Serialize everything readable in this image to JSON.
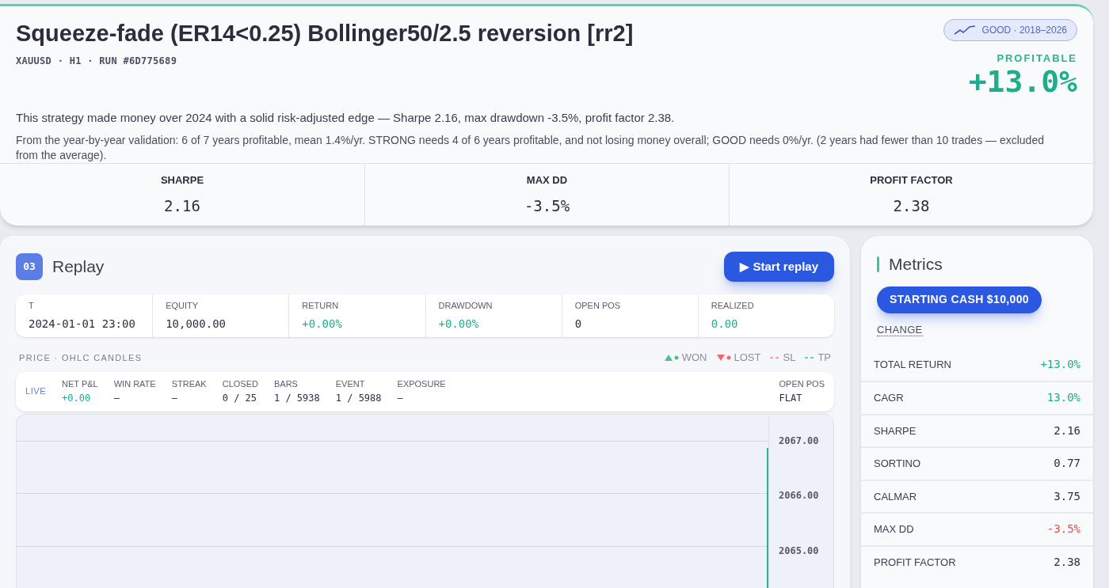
{
  "header": {
    "title": "Squeeze-fade (ER14<0.25) Bollinger50/2.5 reversion [rr2]",
    "subtitle": "XAUUSD · H1 · RUN #6D775689",
    "badge": "GOOD · 2018–2026",
    "verdict": "PROFITABLE",
    "return": "+13.0%",
    "summary": "This strategy made money over 2024 with a solid risk-adjusted edge — Sharpe 2.16, max drawdown -3.5%, profit factor 2.38.",
    "validation": "From the year-by-year validation: 6 of 7 years profitable, mean 1.4%/yr. STRONG needs 4 of 6 years profitable, and not losing money overall; GOOD needs 0%/yr. (2 years had fewer than 10 trades — excluded from the average).",
    "stats": [
      {
        "label": "SHARPE",
        "value": "2.16"
      },
      {
        "label": "MAX DD",
        "value": "-3.5%"
      },
      {
        "label": "PROFIT FACTOR",
        "value": "2.38"
      }
    ]
  },
  "replay": {
    "step": "03",
    "title": "Replay",
    "button": "▶ Start replay",
    "stats": [
      {
        "label": "T",
        "value": "2024-01-01 23:00",
        "color": "#2b2f3f"
      },
      {
        "label": "EQUITY",
        "value": "10,000.00",
        "color": "#2b2f3f"
      },
      {
        "label": "RETURN",
        "value": "+0.00%",
        "color": "#1fae8c"
      },
      {
        "label": "DRAWDOWN",
        "value": "+0.00%",
        "color": "#1fae8c"
      },
      {
        "label": "OPEN POS",
        "value": "0",
        "color": "#2b2f3f"
      },
      {
        "label": "REALIZED",
        "value": "0.00",
        "color": "#1fae8c"
      }
    ],
    "chart_title": "PRICE · OHLC CANDLES",
    "legend": [
      {
        "kind": "won",
        "label": "WON"
      },
      {
        "kind": "lost",
        "label": "LOST"
      },
      {
        "kind": "sl",
        "label": "SL"
      },
      {
        "kind": "tp",
        "label": "TP"
      }
    ],
    "live_label": "LIVE",
    "live_stats": [
      {
        "label": "NET P&L",
        "value": "+0.00",
        "color": "#1fae8c"
      },
      {
        "label": "WIN RATE",
        "value": "—"
      },
      {
        "label": "STREAK",
        "value": "—"
      },
      {
        "label": "CLOSED",
        "value": "0 / 25",
        "color": "#2b2f3f"
      },
      {
        "label": "BARS",
        "value": "1 / 5938",
        "color": "#2b2f3f"
      },
      {
        "label": "EVENT",
        "value": "1 / 5988",
        "color": "#2b2f3f"
      },
      {
        "label": "EXPOSURE",
        "value": "—"
      }
    ],
    "open_pos": {
      "label": "OPEN POS",
      "value": "FLAT"
    },
    "price_axis": [
      "2067.00",
      "2066.00",
      "2065.00"
    ]
  },
  "metrics": {
    "title": "Metrics",
    "cash_button": "STARTING CASH $10,000",
    "change_link": "CHANGE",
    "rows": [
      {
        "label": "TOTAL RETURN",
        "value": "+13.0%",
        "color": "#1fae8c"
      },
      {
        "label": "CAGR",
        "value": "13.0%",
        "color": "#1fae8c"
      },
      {
        "label": "SHARPE",
        "value": "2.16",
        "color": "#2b2f3f"
      },
      {
        "label": "SORTINO",
        "value": "0.77",
        "color": "#2b2f3f"
      },
      {
        "label": "CALMAR",
        "value": "3.75",
        "color": "#2b2f3f"
      },
      {
        "label": "MAX DD",
        "value": "-3.5%",
        "color": "#ef4b4b"
      },
      {
        "label": "PROFIT FACTOR",
        "value": "2.38",
        "color": "#2b2f3f"
      }
    ]
  }
}
